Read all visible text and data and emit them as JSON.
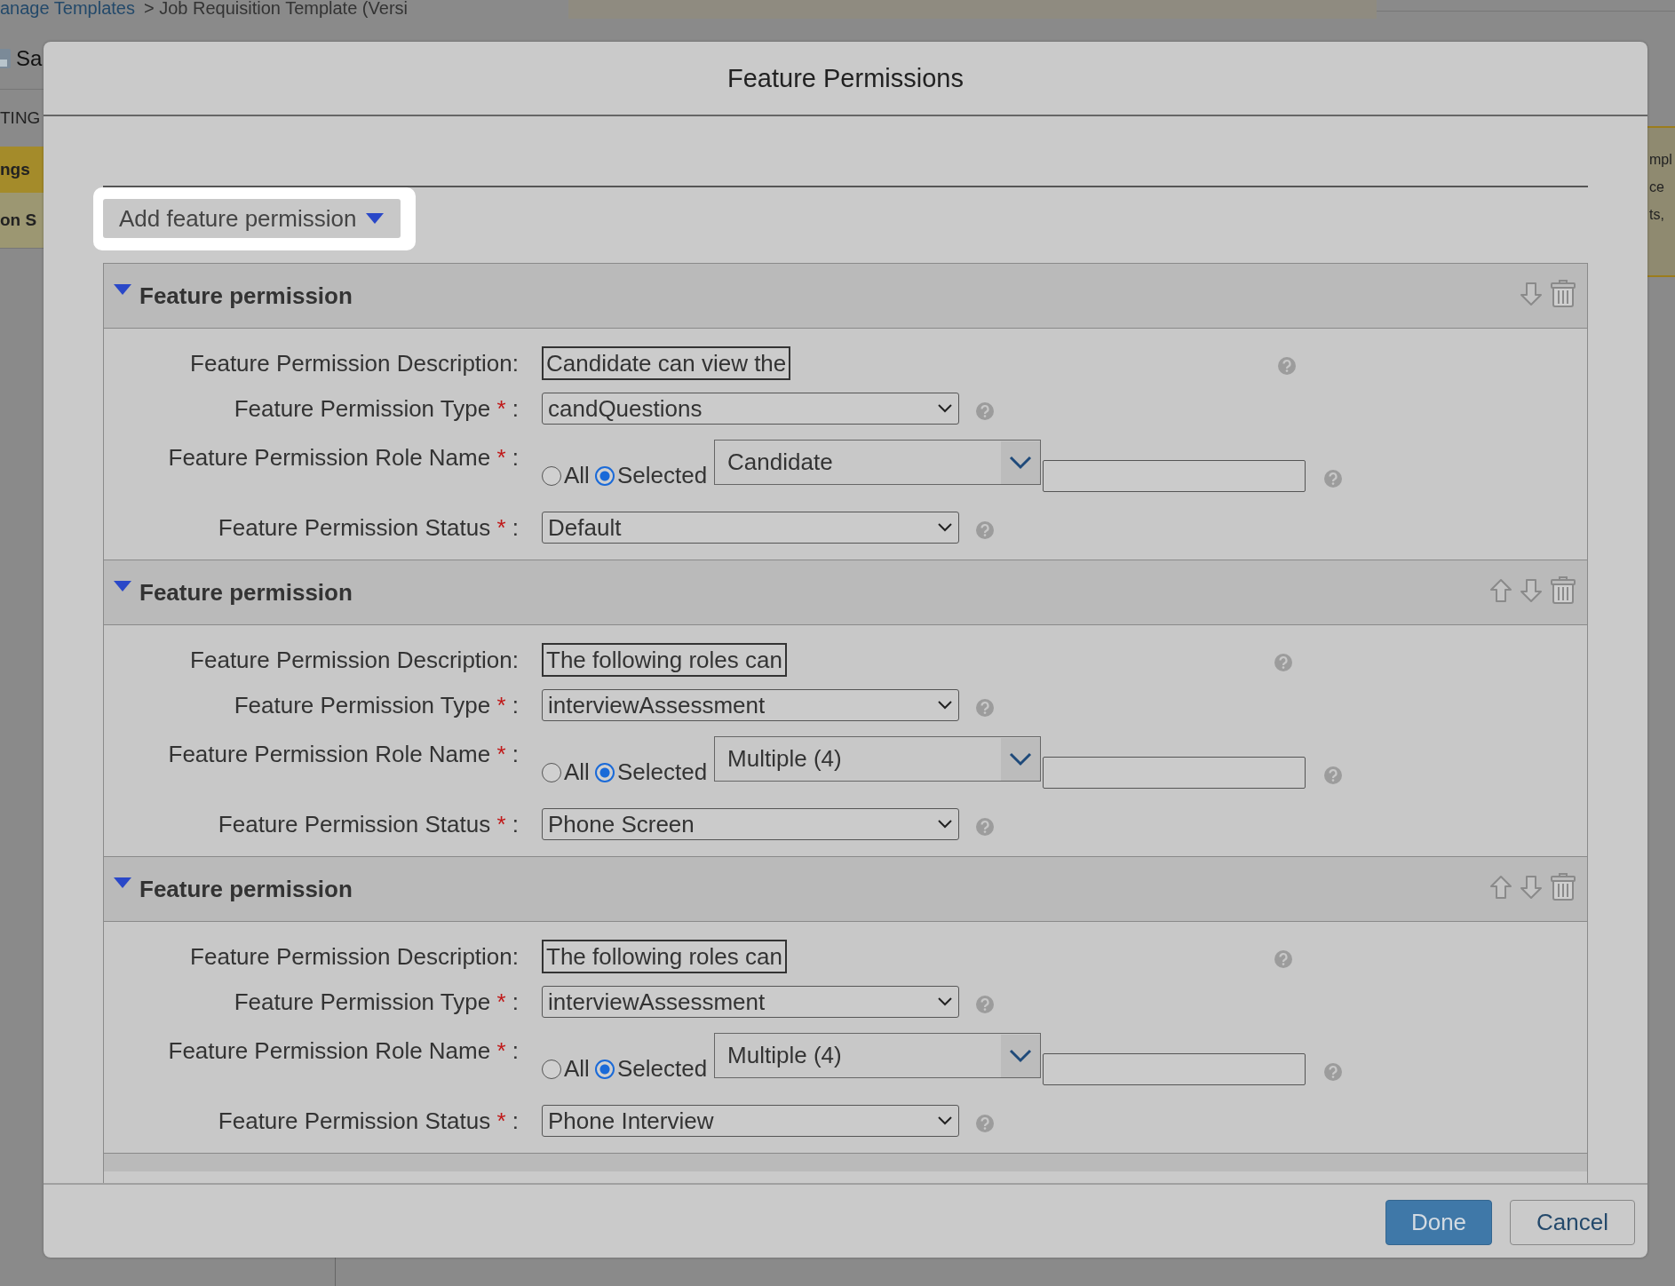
{
  "background": {
    "breadcrumb_link": "anage Templates",
    "breadcrumb_text": "> Job Requisition Template (Versi",
    "save_label": "Sa",
    "left_fragments": [
      {
        "text": "TING",
        "kind": "plain"
      },
      {
        "text": "ngs",
        "kind": "highlight"
      },
      {
        "text": "on S",
        "kind": "muted"
      }
    ],
    "right_fragments": [
      "mpl",
      "ce",
      "ts,"
    ]
  },
  "dialog": {
    "title": "Feature Permissions",
    "add_button": {
      "label": "Add feature permission",
      "highlighted": true
    },
    "sections": [
      {
        "title": "Feature permission",
        "expanded": true,
        "can_move_up": false,
        "can_move_down": true,
        "rows": [
          {
            "kind": "text",
            "label": "Feature Permission Description:",
            "value": "Candidate can view the"
          },
          {
            "kind": "select",
            "label": "Feature Permission Type",
            "required_mark": "*",
            "colon": ":",
            "value": "candQuestions"
          },
          {
            "kind": "role",
            "label": "Feature Permission Role Name",
            "required_mark": "*",
            "colon": ":",
            "options": [
              {
                "label": "All",
                "selected": false
              },
              {
                "label": "Selected",
                "selected": true
              }
            ],
            "value": "Candidate"
          },
          {
            "kind": "select",
            "label": "Feature Permission Status",
            "required_mark": "*",
            "colon": ":",
            "value": "Default"
          }
        ]
      },
      {
        "title": "Feature permission",
        "expanded": true,
        "can_move_up": true,
        "can_move_down": true,
        "rows": [
          {
            "kind": "text",
            "label": "Feature Permission Description:",
            "value": "The following roles can"
          },
          {
            "kind": "select",
            "label": "Feature Permission Type",
            "required_mark": "*",
            "colon": ":",
            "value": "interviewAssessment"
          },
          {
            "kind": "role",
            "label": "Feature Permission Role Name",
            "required_mark": "*",
            "colon": ":",
            "options": [
              {
                "label": "All",
                "selected": false
              },
              {
                "label": "Selected",
                "selected": true
              }
            ],
            "value": "Multiple (4)"
          },
          {
            "kind": "select",
            "label": "Feature Permission Status",
            "required_mark": "*",
            "colon": ":",
            "value": "Phone Screen"
          }
        ]
      },
      {
        "title": "Feature permission",
        "expanded": true,
        "can_move_up": true,
        "can_move_down": true,
        "rows": [
          {
            "kind": "text",
            "label": "Feature Permission Description:",
            "value": "The following roles can"
          },
          {
            "kind": "select",
            "label": "Feature Permission Type",
            "required_mark": "*",
            "colon": ":",
            "value": "interviewAssessment"
          },
          {
            "kind": "role",
            "label": "Feature Permission Role Name",
            "required_mark": "*",
            "colon": ":",
            "options": [
              {
                "label": "All",
                "selected": false
              },
              {
                "label": "Selected",
                "selected": true
              }
            ],
            "value": "Multiple (4)"
          },
          {
            "kind": "select",
            "label": "Feature Permission Status",
            "required_mark": "*",
            "colon": ":",
            "value": "Phone Interview"
          }
        ]
      }
    ],
    "buttons": [
      {
        "label": "Done",
        "kind": "primary"
      },
      {
        "label": "Cancel",
        "kind": "secondary"
      }
    ]
  }
}
